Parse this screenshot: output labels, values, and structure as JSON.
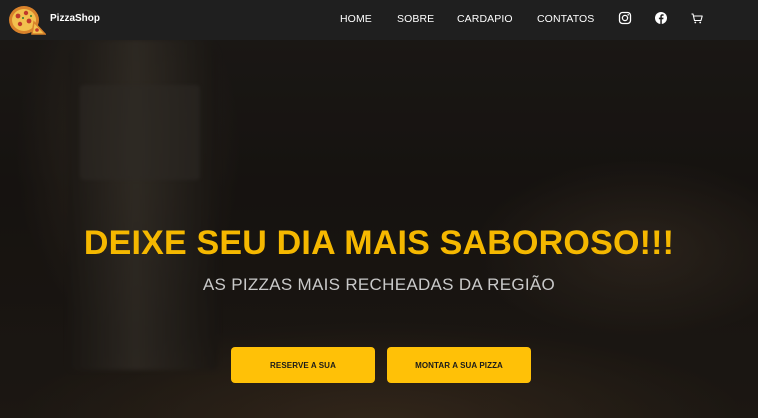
{
  "brand": {
    "name": "PizzaShop",
    "logo_icon": "pizza-icon"
  },
  "nav": {
    "links": [
      "HOME",
      "SOBRE",
      "CARDAPIO",
      "CONTATOS"
    ],
    "icons": [
      "instagram-icon",
      "facebook-icon",
      "cart-icon"
    ]
  },
  "hero": {
    "headline": "DEIXE SEU DIA MAIS SABOROSO!!!",
    "subheadline": "AS PIZZAS MAIS RECHEADAS DA REGIÃO",
    "buttons": [
      "RESERVE A SUA",
      "MONTAR A SUA PIZZA"
    ],
    "background": "pizza-and-wine-photo"
  },
  "colors": {
    "accent": "#ffc107",
    "headline": "#f5b800",
    "navbar": "#1f1f1f"
  }
}
